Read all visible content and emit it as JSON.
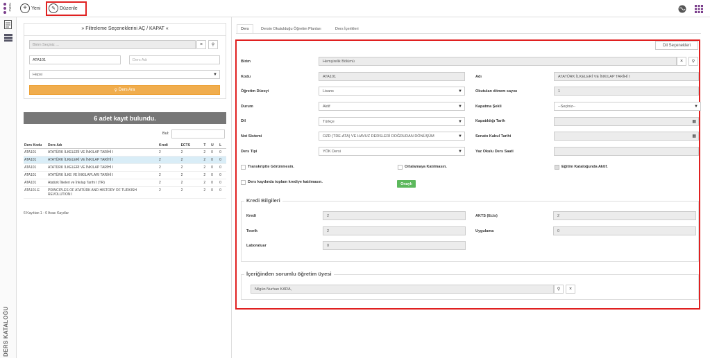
{
  "topbar": {
    "menu_label": "menu",
    "new_label": "Yeni",
    "edit_label": "Düzenle"
  },
  "sidebar": {
    "vertical_title": "DERS KATALOĞU"
  },
  "filter": {
    "header": "» Filtreleme Seçeneklerini AÇ / KAPAT «",
    "unit_placeholder": "Birim Seçiniz ...",
    "code_value": "ATA101",
    "name_placeholder": "Ders Adı",
    "select_value": "Hepsi",
    "search_button": "Ders Ara"
  },
  "results": {
    "banner": "6 adet kayıt bulundu.",
    "find_label": "Bul:",
    "columns": [
      "Ders Kodu",
      "Ders Adı",
      "Kredi",
      "ECTS",
      "T",
      "U",
      "L"
    ],
    "rows": [
      [
        "ATA101",
        "ATATÜRK İLKELERİ VE İNKILAP TARİHİ I",
        "2",
        "2",
        "2",
        "0",
        "0"
      ],
      [
        "ATA101",
        "ATATÜRK İLKELERİ VE İNKILAP TARİHİ I",
        "2",
        "2",
        "2",
        "0",
        "0"
      ],
      [
        "ATA101",
        "ATATÜRK İLKELERİ VE İNKILAP TARİHİ I",
        "2",
        "2",
        "2",
        "0",
        "0"
      ],
      [
        "ATA101",
        "ATATÜRK İLKE VE İNKILAPLARI TARİHİ I",
        "2",
        "2",
        "2",
        "0",
        "0"
      ],
      [
        "ATA101",
        "Atatürk İlkeleri ve İnkılap Tarihi I (TR)",
        "2",
        "2",
        "2",
        "0",
        "0"
      ],
      [
        "ATA101.E",
        "PRINCIPLES OF ATATÜRK AND HISTORY OF TURKISH REVOLUTION I",
        "2",
        "2",
        "2",
        "0",
        "0"
      ]
    ],
    "footer": "6 Kayıttan 1 - 6 Arası Kayıtlar"
  },
  "tabs": [
    "Ders",
    "Dersin Okutulduğu Öğretim Planları",
    "Ders İçerikleri"
  ],
  "form": {
    "lang_button": "Dil Seçenekleri",
    "birim_label": "Birim",
    "birim_value": "Hemşirelik Bölümü",
    "kodu_label": "Kodu",
    "kodu_value": "ATA101",
    "adi_label": "Adı",
    "adi_value": "ATATÜRK İLKELERİ VE İNKILAP TARİHİ I",
    "ogretim_label": "Öğretim Düzeyi",
    "ogretim_value": "Lisans",
    "donem_label": "Okutulan dönem sayısı",
    "donem_value": "1",
    "durum_label": "Durum",
    "durum_value": "Aktif",
    "kapatma_label": "Kapatma Şekli",
    "kapatma_value": "--Seçiniz--",
    "dil_label": "Dil",
    "dil_value": "Türkçe",
    "kapatildigi_label": "Kapatıldığı Tarih",
    "not_label": "Not Sistemi",
    "not_value": "OZD (TDE-ATA) VE HAVUZ DERSLERİ DOĞRUDAN DÖNÜŞÜM",
    "senato_label": "Senato Kabul Tarihi",
    "tipi_label": "Ders Tipi",
    "tipi_value": "YÖK Dersi",
    "yaz_label": "Yaz Okulu Ders Saati",
    "chk_transkript": "Transkriptte Görünmesin.",
    "chk_ortalama": "Ortalamaya Katılmasın.",
    "chk_katalog": "Eğitim Kataloğunda Aktif.",
    "chk_kredi": "Ders kaydında toplam krediye katılmasın.",
    "onayli": "Onaylı",
    "kredi_section": "Kredi Bilgileri",
    "kredi_label": "Kredi",
    "kredi_value": "2",
    "akts_label": "AKTS (Ects)",
    "akts_value": "2",
    "teorik_label": "Teorik",
    "teorik_value": "2",
    "uygulama_label": "Uygulama",
    "uygulama_value": "0",
    "lab_label": "Laboratuar",
    "lab_value": "0",
    "sorumlu_section": "İçeriğinden sorumlu öğretim üyesi",
    "sorumlu_value": "Nilgün Nurhan KARA,"
  },
  "colors": {
    "accent_red": "#e02020",
    "orange": "#f0ad4e",
    "green": "#5cb85c"
  },
  "icons": [
    "menu-dots-icon",
    "plus-icon",
    "edit-icon",
    "globe-icon",
    "apps-grid-icon",
    "document-icon",
    "list-icon",
    "close-icon",
    "search-icon",
    "calendar-icon",
    "caret-down-icon"
  ]
}
